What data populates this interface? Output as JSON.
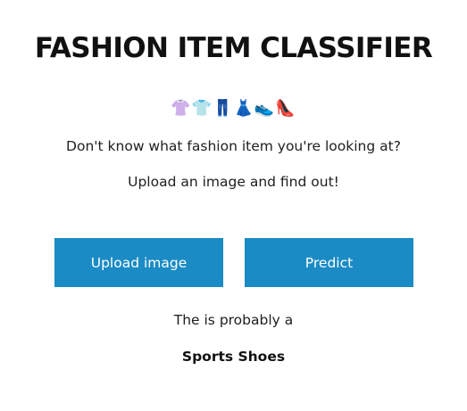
{
  "header": {
    "title": "FASHION ITEM CLASSIFIER",
    "emoji": "👚👕👖👗👟👠"
  },
  "intro": {
    "line_1": "Don't know what fashion item you're looking at?",
    "line_2": "Upload an image and find out!"
  },
  "actions": {
    "upload_label": "Upload image",
    "predict_label": "Predict"
  },
  "result": {
    "label": "The is probably a",
    "value": "Sports Shoes"
  },
  "colors": {
    "button_bg": "#1a8bc5",
    "button_text": "#ffffff",
    "text": "#202020"
  }
}
